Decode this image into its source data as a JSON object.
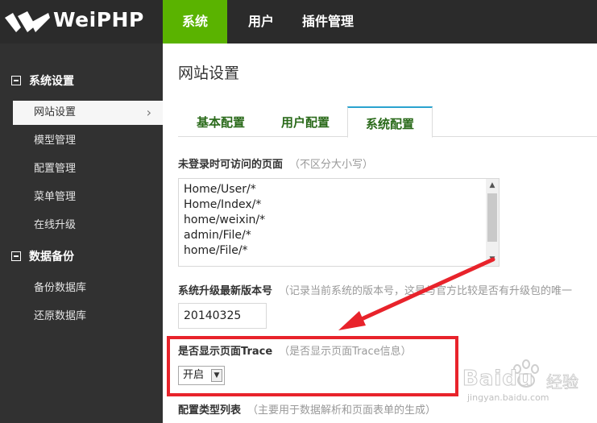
{
  "brand": {
    "name": "WeiPHP"
  },
  "topnav": [
    {
      "label": "系统"
    },
    {
      "label": "用户"
    },
    {
      "label": "插件管理"
    }
  ],
  "sidebar": {
    "groups": [
      {
        "title": "系统设置",
        "items": [
          "网站设置",
          "模型管理",
          "配置管理",
          "菜单管理",
          "在线升级"
        ]
      },
      {
        "title": "数据备份",
        "items": [
          "备份数据库",
          "还原数据库"
        ]
      }
    ],
    "active_chevron": "›"
  },
  "page": {
    "title": "网站设置"
  },
  "tabs": [
    {
      "label": "基本配置"
    },
    {
      "label": "用户配置"
    },
    {
      "label": "系统配置"
    }
  ],
  "fields": {
    "pages": {
      "label": "未登录时可访问的页面",
      "hint": "（不区分大小写）",
      "lines": [
        "Home/User/*",
        "Home/Index/*",
        "home/weixin/*",
        "admin/File/*",
        "home/File/*"
      ]
    },
    "version": {
      "label": "系统升级最新版本号",
      "hint": "（记录当前系统的版本号，这是与官方比较是否有升级包的唯一",
      "value": "20140325"
    },
    "trace": {
      "label": "是否显示页面Trace",
      "hint": "（是否显示页面Trace信息）",
      "selected": "开启"
    },
    "config_types": {
      "label": "配置类型列表",
      "hint": "（主要用于数据解析和页面表单的生成）"
    }
  },
  "watermark": {
    "brand": "Baidu",
    "suffix": "经验",
    "url": "jingyan.baidu.com"
  },
  "colors": {
    "accent": "#5ab300",
    "tab_active_border": "#2aa3cf",
    "highlight": "#e8232b",
    "topbar": "#2b2b2b",
    "sidebar": "#313131"
  }
}
